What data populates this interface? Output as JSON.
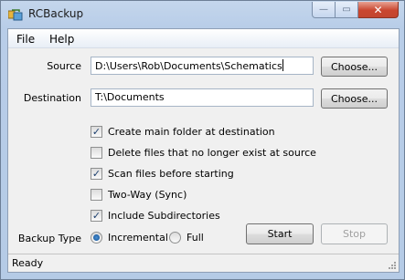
{
  "window": {
    "title": "RCBackup",
    "minimize_glyph": "—",
    "maximize_glyph": "▭",
    "close_glyph": "✕"
  },
  "menu": [
    {
      "label": "File"
    },
    {
      "label": "Help"
    }
  ],
  "source": {
    "label": "Source",
    "value": "D:\\Users\\Rob\\Documents\\Schematics",
    "button_label": "Choose..."
  },
  "destination": {
    "label": "Destination",
    "value": "T:\\Documents",
    "button_label": "Choose..."
  },
  "options": [
    {
      "label": "Create main folder at destination",
      "checked": true
    },
    {
      "label": "Delete files that no longer exist at source",
      "checked": false
    },
    {
      "label": "Scan files before starting",
      "checked": true
    },
    {
      "label": "Two-Way (Sync)",
      "checked": false
    },
    {
      "label": "Include Subdirectories",
      "checked": true
    }
  ],
  "backup_type": {
    "label": "Backup Type",
    "options": [
      {
        "label": "Incremental",
        "selected": true
      },
      {
        "label": "Full",
        "selected": false
      }
    ]
  },
  "buttons": {
    "start": "Start",
    "stop": "Stop"
  },
  "status": {
    "text": "Ready"
  },
  "icons": {
    "app": "rcbackup-app-icon",
    "check": "✓"
  }
}
